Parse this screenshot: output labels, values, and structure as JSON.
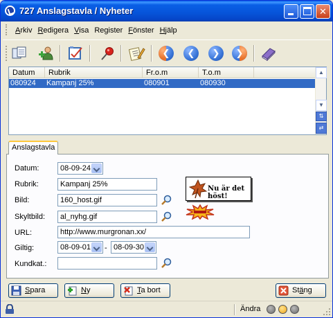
{
  "window": {
    "title": "727 Anslagstavla / Nyheter"
  },
  "menu": {
    "items": [
      {
        "pre": "",
        "key": "A",
        "post": "rkiv"
      },
      {
        "pre": "",
        "key": "R",
        "post": "edigera"
      },
      {
        "pre": "",
        "key": "V",
        "post": "isa"
      },
      {
        "pre": "Re",
        "key": "g",
        "post": "ister"
      },
      {
        "pre": "",
        "key": "F",
        "post": "önster"
      },
      {
        "pre": "",
        "key": "H",
        "post": "jälp"
      }
    ]
  },
  "toolbar": {
    "icons": [
      "copy-records-icon",
      "add-user-icon",
      "edit-note-icon",
      "pushpin-icon",
      "notepad-pencil-icon",
      "first-record-icon",
      "previous-record-icon",
      "next-record-icon",
      "last-record-icon",
      "book-icon"
    ],
    "colors": {
      "nav_blue": "#3a76d8",
      "nav_orange": "#e8732c"
    }
  },
  "list": {
    "columns": [
      "Datum",
      "Rubrik",
      "Fr.o.m",
      "T.o.m"
    ],
    "rows": [
      {
        "datum": "080924",
        "rubrik": "Kampanj 25%",
        "from": "080901",
        "tom": "080930"
      }
    ],
    "selected_color": "#316ac5"
  },
  "tab": {
    "label": "Anslagstavla"
  },
  "form": {
    "datum_label": "Datum:",
    "datum_value": "08-09-24",
    "rubrik_label": "Rubrik:",
    "rubrik_value": "Kampanj 25%",
    "bild_label": "Bild:",
    "bild_value": "160_host.gif",
    "skyltbild_label": "Skyltbild:",
    "skyltbild_value": "al_nyhg.gif",
    "url_label": "URL:",
    "url_value": "http://www.murgronan.xx/",
    "giltig_label": "Giltig:",
    "giltig_from": "08-09-01",
    "giltig_sep": "-",
    "giltig_to": "08-09-30",
    "kundkat_label": "Kundkat.:",
    "kundkat_value": ""
  },
  "preview": {
    "bild_text": "Nu är det höst!"
  },
  "buttons": {
    "save": {
      "key": "S",
      "post": "para"
    },
    "new": {
      "key": "N",
      "post": "y"
    },
    "delete": {
      "key": "T",
      "post": "a bort"
    },
    "close": {
      "pre": "St",
      "key": "ä",
      "post": "ng"
    }
  },
  "status": {
    "mode": "Ändra"
  }
}
